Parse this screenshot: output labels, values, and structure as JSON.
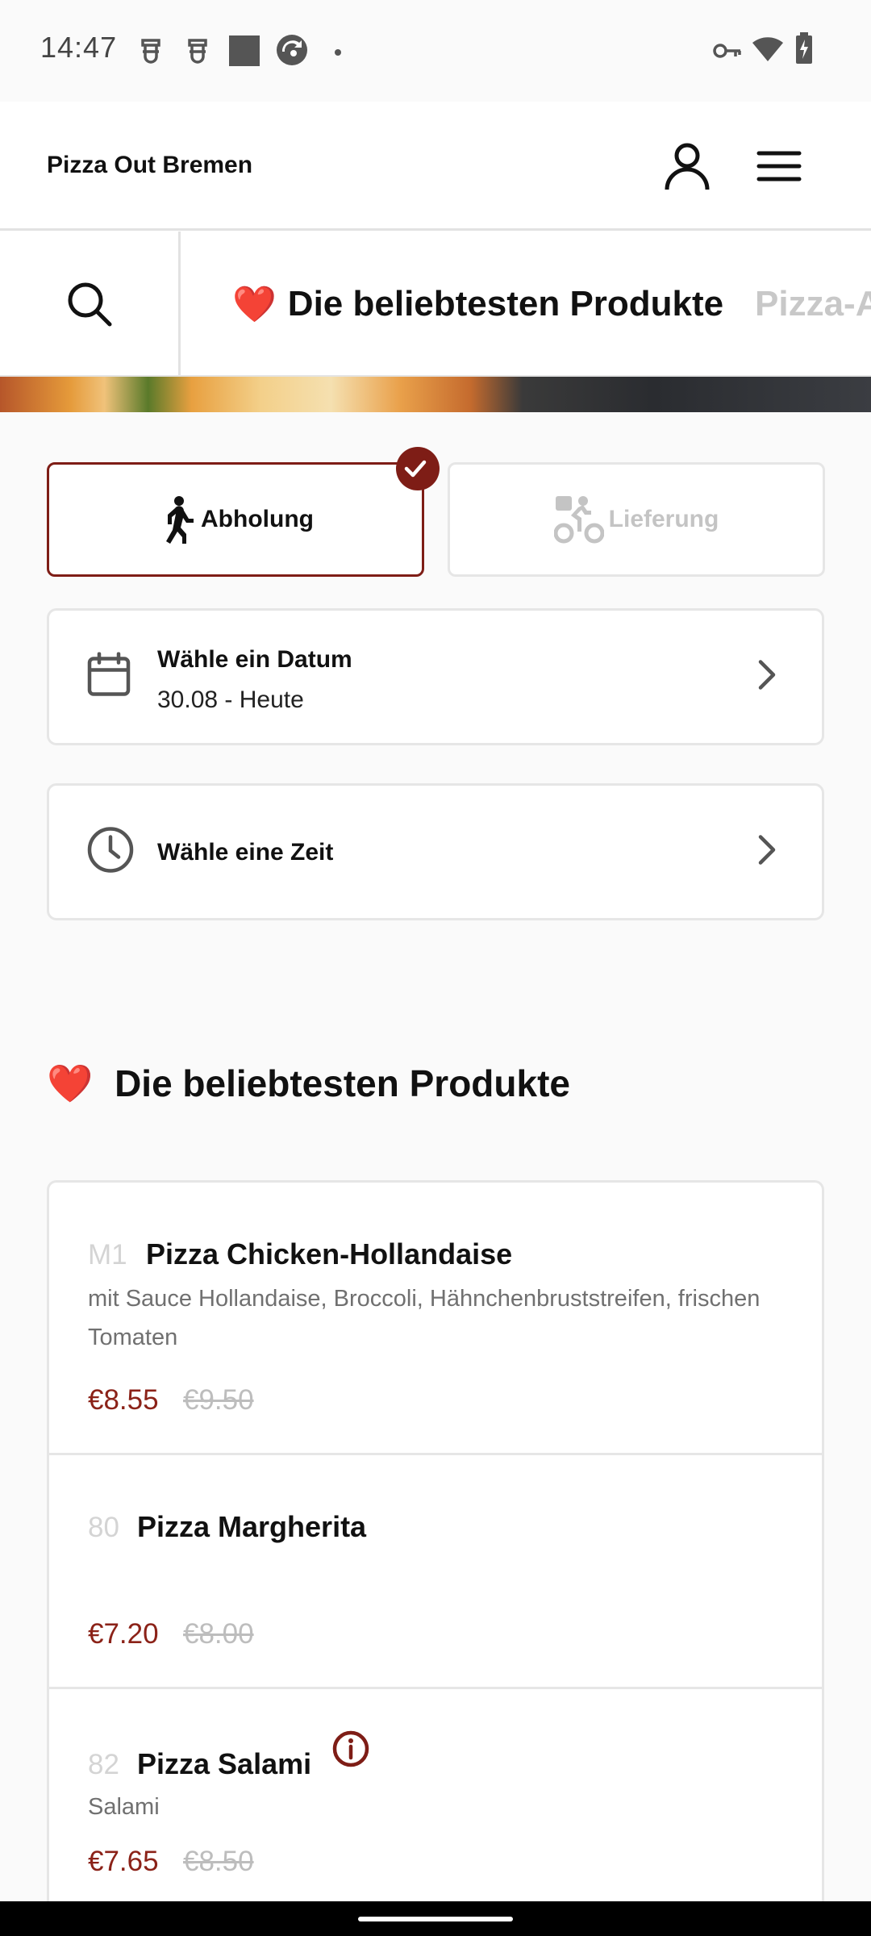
{
  "status_bar": {
    "time": "14:47"
  },
  "header": {
    "title": "Pizza Out Bremen"
  },
  "category_bar": {
    "tabs": [
      {
        "label": "Die beliebtesten Produkte",
        "emoji": "❤️"
      },
      {
        "label": "Pizza-A"
      }
    ]
  },
  "order_mode": {
    "pickup_label": "Abholung",
    "delivery_label": "Lieferung",
    "selected": "pickup"
  },
  "date_selector": {
    "title": "Wähle ein Datum",
    "value": "30.08 - Heute"
  },
  "time_selector": {
    "title": "Wähle eine Zeit"
  },
  "section": {
    "title": "Die beliebtesten Produkte",
    "emoji": "❤️"
  },
  "products": [
    {
      "number": "M1",
      "name": "Pizza Chicken-Hollandaise",
      "description": "mit Sauce Hollandaise, Broccoli, Hähnchenbruststreifen, frischen Tomaten",
      "price": "€8.55",
      "old_price": "€9.50"
    },
    {
      "number": "80",
      "name": "Pizza Margherita",
      "description": "",
      "price": "€7.20",
      "old_price": "€8.00"
    },
    {
      "number": "82",
      "name": "Pizza Salami",
      "description": "Salami",
      "price": "€7.65",
      "old_price": "€8.50"
    }
  ],
  "colors": {
    "accent": "#7e1d16",
    "price": "#8b2218",
    "muted": "#c4c4c4",
    "border": "#e6e6e6"
  }
}
